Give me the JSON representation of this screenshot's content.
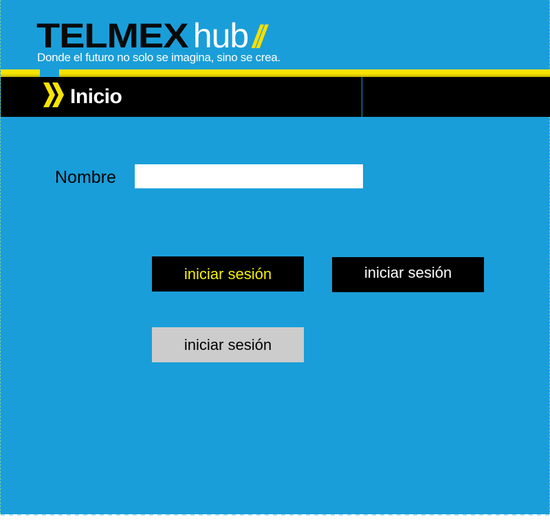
{
  "header": {
    "brand": "TELMEX",
    "brand_suffix": "hub",
    "brand_mark": "//",
    "tagline": "Donde el futuro no solo se imagina, sino se crea."
  },
  "titlebar": {
    "icon": "double-chevron-icon",
    "title": "Inicio"
  },
  "form": {
    "name_label": "Nombre",
    "name_value": "",
    "login_button_1": "iniciar sesión",
    "login_button_2": "iniciar sesión",
    "login_button_3": "iniciar sesión"
  },
  "colors": {
    "background": "#1a9ed9",
    "accent_yellow": "#f6e400",
    "bar_black": "#000000",
    "button_gray": "#cccccc"
  }
}
